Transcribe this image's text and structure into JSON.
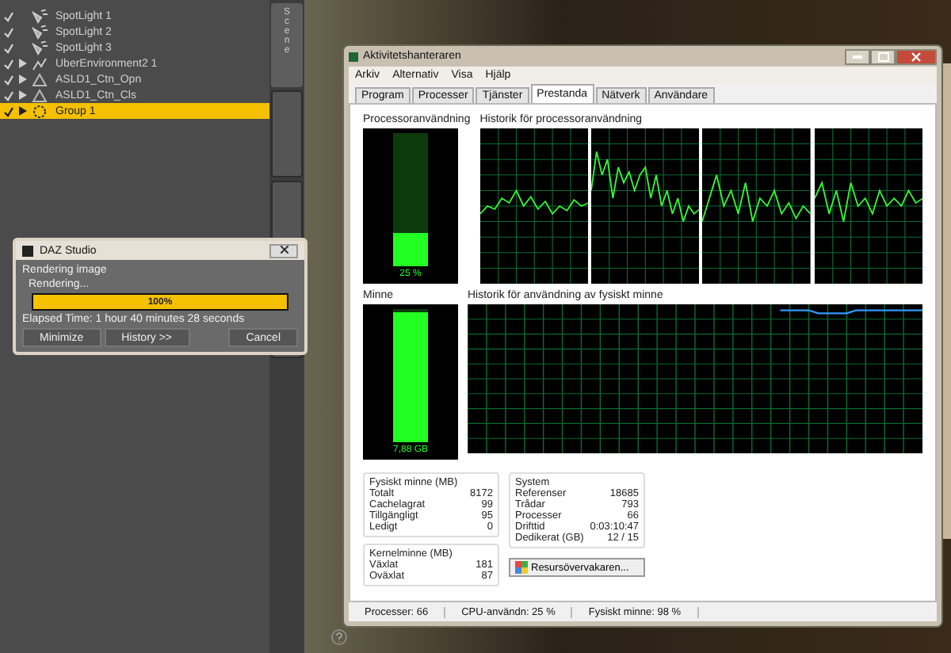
{
  "scene_list": [
    {
      "label": "SpotLight 1",
      "kind": "light",
      "visible": true,
      "expandable": false,
      "selected": false
    },
    {
      "label": "SpotLight 2",
      "kind": "light",
      "visible": true,
      "expandable": false,
      "selected": false
    },
    {
      "label": "SpotLight 3",
      "kind": "light",
      "visible": true,
      "expandable": false,
      "selected": false
    },
    {
      "label": "UberEnvironment2 1",
      "kind": "environment",
      "visible": true,
      "expandable": true,
      "selected": false
    },
    {
      "label": "ASLD1_Ctn_Opn",
      "kind": "figure",
      "visible": true,
      "expandable": true,
      "selected": false
    },
    {
      "label": "ASLD1_Ctn_Cls",
      "kind": "figure",
      "visible": true,
      "expandable": true,
      "selected": false
    },
    {
      "label": "Group 1",
      "kind": "group",
      "visible": true,
      "expandable": true,
      "selected": true
    }
  ],
  "side_tabs": [
    {
      "label": "Scene",
      "selected": true
    },
    {
      "selected": false
    },
    {
      "selected": false
    },
    {
      "selected": false
    }
  ],
  "render_dialog": {
    "title": "DAZ Studio",
    "heading": "Rendering image",
    "status": "Rendering...",
    "progress": {
      "level": 1.0,
      "reading": "100%"
    },
    "elapsed": "Elapsed Time:  1 hour 40 minutes 28 seconds",
    "buttons": [
      "Minimize",
      "History >>",
      "Cancel"
    ]
  },
  "task_manager": {
    "title": "Aktivitetshanteraren",
    "menu": [
      "Arkiv",
      "Alternativ",
      "Visa",
      "Hjälp"
    ],
    "tabs": [
      {
        "label": "Program",
        "selected": false
      },
      {
        "label": "Processer",
        "selected": false
      },
      {
        "label": "Tjänster",
        "selected": false
      },
      {
        "label": "Prestanda",
        "selected": true
      },
      {
        "label": "Nätverk",
        "selected": false
      },
      {
        "label": "Användare",
        "selected": false
      }
    ],
    "cpu_usage": {
      "title": "Processoranvändning",
      "level": 0.25,
      "reading": "25 %"
    },
    "cpu_history": {
      "title": "Historik för processoranvändning"
    },
    "memory": {
      "title": "Minne",
      "level": 0.98,
      "reading": "7,88 GB"
    },
    "memory_history": {
      "title": "Historik för användning av fysiskt minne"
    },
    "physical_memory": {
      "title": "Fysiskt minne (MB)",
      "rows": [
        [
          "Totalt",
          "8172"
        ],
        [
          "Cachelagrat",
          "99"
        ],
        [
          "Tillgängligt",
          "95"
        ],
        [
          "Ledigt",
          "0"
        ]
      ]
    },
    "kernel_memory": {
      "title": "Kernelminne (MB)",
      "rows": [
        [
          "Växlat",
          "181"
        ],
        [
          "Oväxlat",
          "87"
        ]
      ]
    },
    "system": {
      "title": "System",
      "rows": [
        [
          "Referenser",
          "18685"
        ],
        [
          "Trådar",
          "793"
        ],
        [
          "Processer",
          "66"
        ],
        [
          "Drifttid",
          "0:03:10:47"
        ],
        [
          "Dedikerat (GB)",
          "12 / 15"
        ]
      ]
    },
    "resource_button": "Resursövervakaren...",
    "status_bar": [
      "Processer: 66",
      "CPU-användn: 25 %",
      "Fysiskt minne: 98 %"
    ]
  }
}
